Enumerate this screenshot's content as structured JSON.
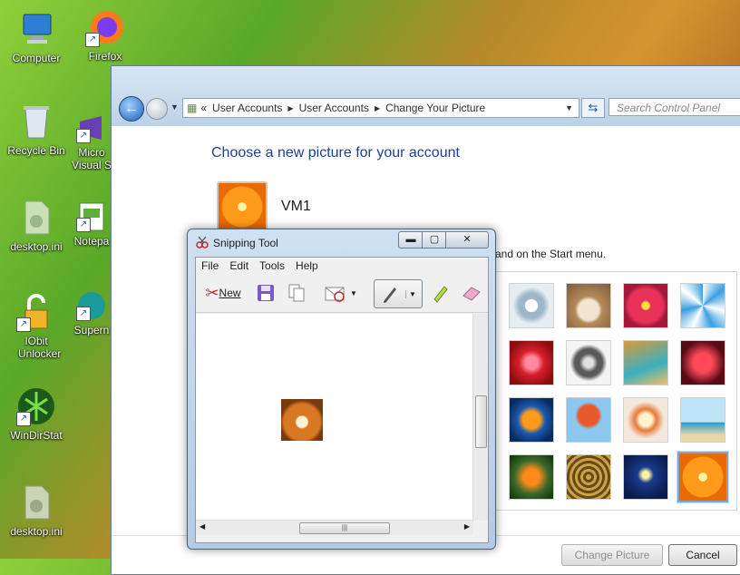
{
  "desktop": {
    "icons": [
      {
        "label": "Computer"
      },
      {
        "label": "Firefox"
      },
      {
        "label": "Recycle Bin"
      },
      {
        "label": "Micro Visual S"
      },
      {
        "label": "desktop.ini"
      },
      {
        "label": "Notepa"
      },
      {
        "label": "IObit Unlocker"
      },
      {
        "label": "Supern"
      },
      {
        "label": "WinDirStat"
      },
      {
        "label": "desktop.ini"
      }
    ]
  },
  "control_panel": {
    "breadcrumb": [
      "«",
      "User Accounts",
      "User Accounts",
      "Change Your Picture"
    ],
    "search_placeholder": "Search Control Panel",
    "heading": "Choose a new picture for your account",
    "username": "VM1",
    "partial_text": "and on the Start menu.",
    "change_button": "Change Picture",
    "cancel_button": "Cancel",
    "pictures": [
      "gyroscope",
      "kitten",
      "pink-flower",
      "pinwheel",
      "red-star",
      "jacks",
      "stairs",
      "origami-crane",
      "fish",
      "hot-air-balloon",
      "figurine",
      "sailboat",
      "butterfly",
      "basket-weave",
      "lighthouse",
      "orange-flower"
    ]
  },
  "snipping_tool": {
    "title": "Snipping Tool",
    "menu": [
      "File",
      "Edit",
      "Tools",
      "Help"
    ],
    "new_label": "New"
  },
  "colors": {
    "accent": "#1e3f9a",
    "title_bar": "#cfe0f1"
  }
}
